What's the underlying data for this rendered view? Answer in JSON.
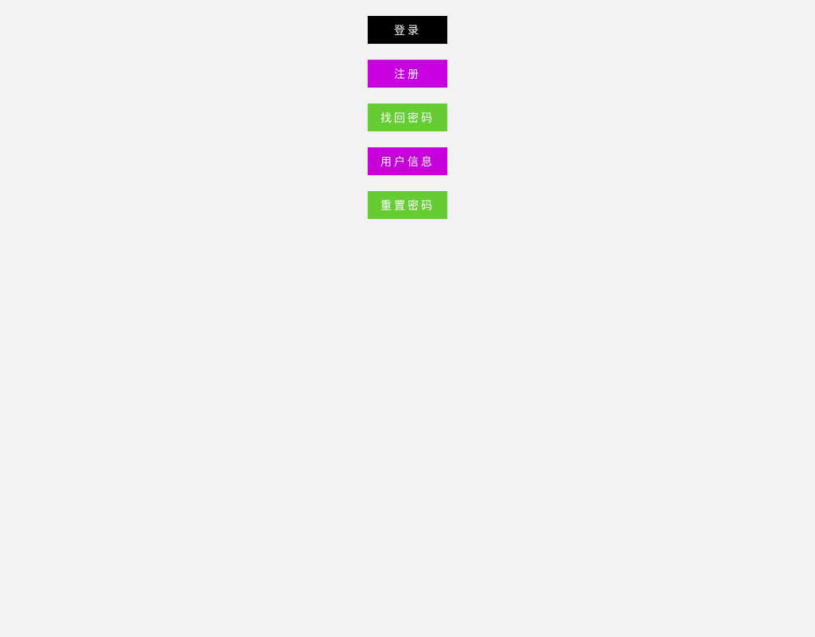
{
  "buttons": {
    "login": "登录",
    "register": "注册",
    "recover_password": "找回密码",
    "user_info": "用户信息",
    "reset_password": "重置密码"
  }
}
